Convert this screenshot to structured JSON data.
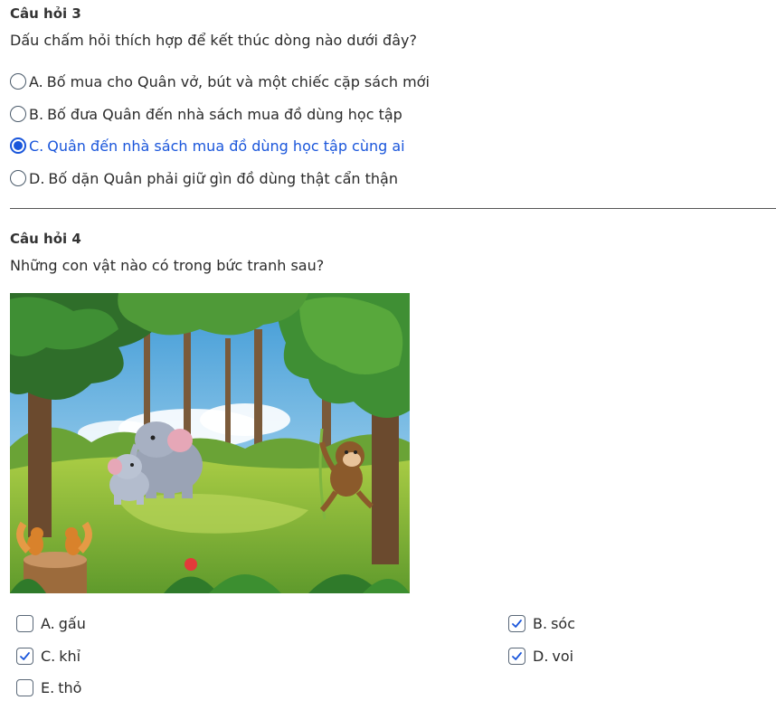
{
  "question3": {
    "title": "Câu hỏi 3",
    "text": "Dấu chấm hỏi thích hợp để kết thúc dòng nào dưới đây?",
    "options": [
      {
        "letter": "A.",
        "label": "Bố mua cho Quân vở, bút và một chiếc cặp sách mới",
        "selected": false
      },
      {
        "letter": "B.",
        "label": "Bố đưa Quân đến nhà sách mua đồ dùng học tập",
        "selected": false
      },
      {
        "letter": "C.",
        "label": "Quân đến nhà sách mua đồ dùng học tập cùng ai",
        "selected": true
      },
      {
        "letter": "D.",
        "label": "Bố dặn Quân phải giữ gìn đồ dùng thật cẩn thận",
        "selected": false
      }
    ]
  },
  "question4": {
    "title": "Câu hỏi 4",
    "text": "Những con vật nào có trong bức tranh sau?",
    "options": [
      {
        "letter": "A.",
        "label": "gấu",
        "checked": false
      },
      {
        "letter": "B.",
        "label": "sóc",
        "checked": true
      },
      {
        "letter": "C.",
        "label": "khỉ",
        "checked": true
      },
      {
        "letter": "D.",
        "label": "voi",
        "checked": true
      },
      {
        "letter": "E.",
        "label": "thỏ",
        "checked": false
      }
    ]
  },
  "colors": {
    "accent": "#1a56db",
    "text": "#2b2b2b",
    "check": "#1a56db"
  }
}
